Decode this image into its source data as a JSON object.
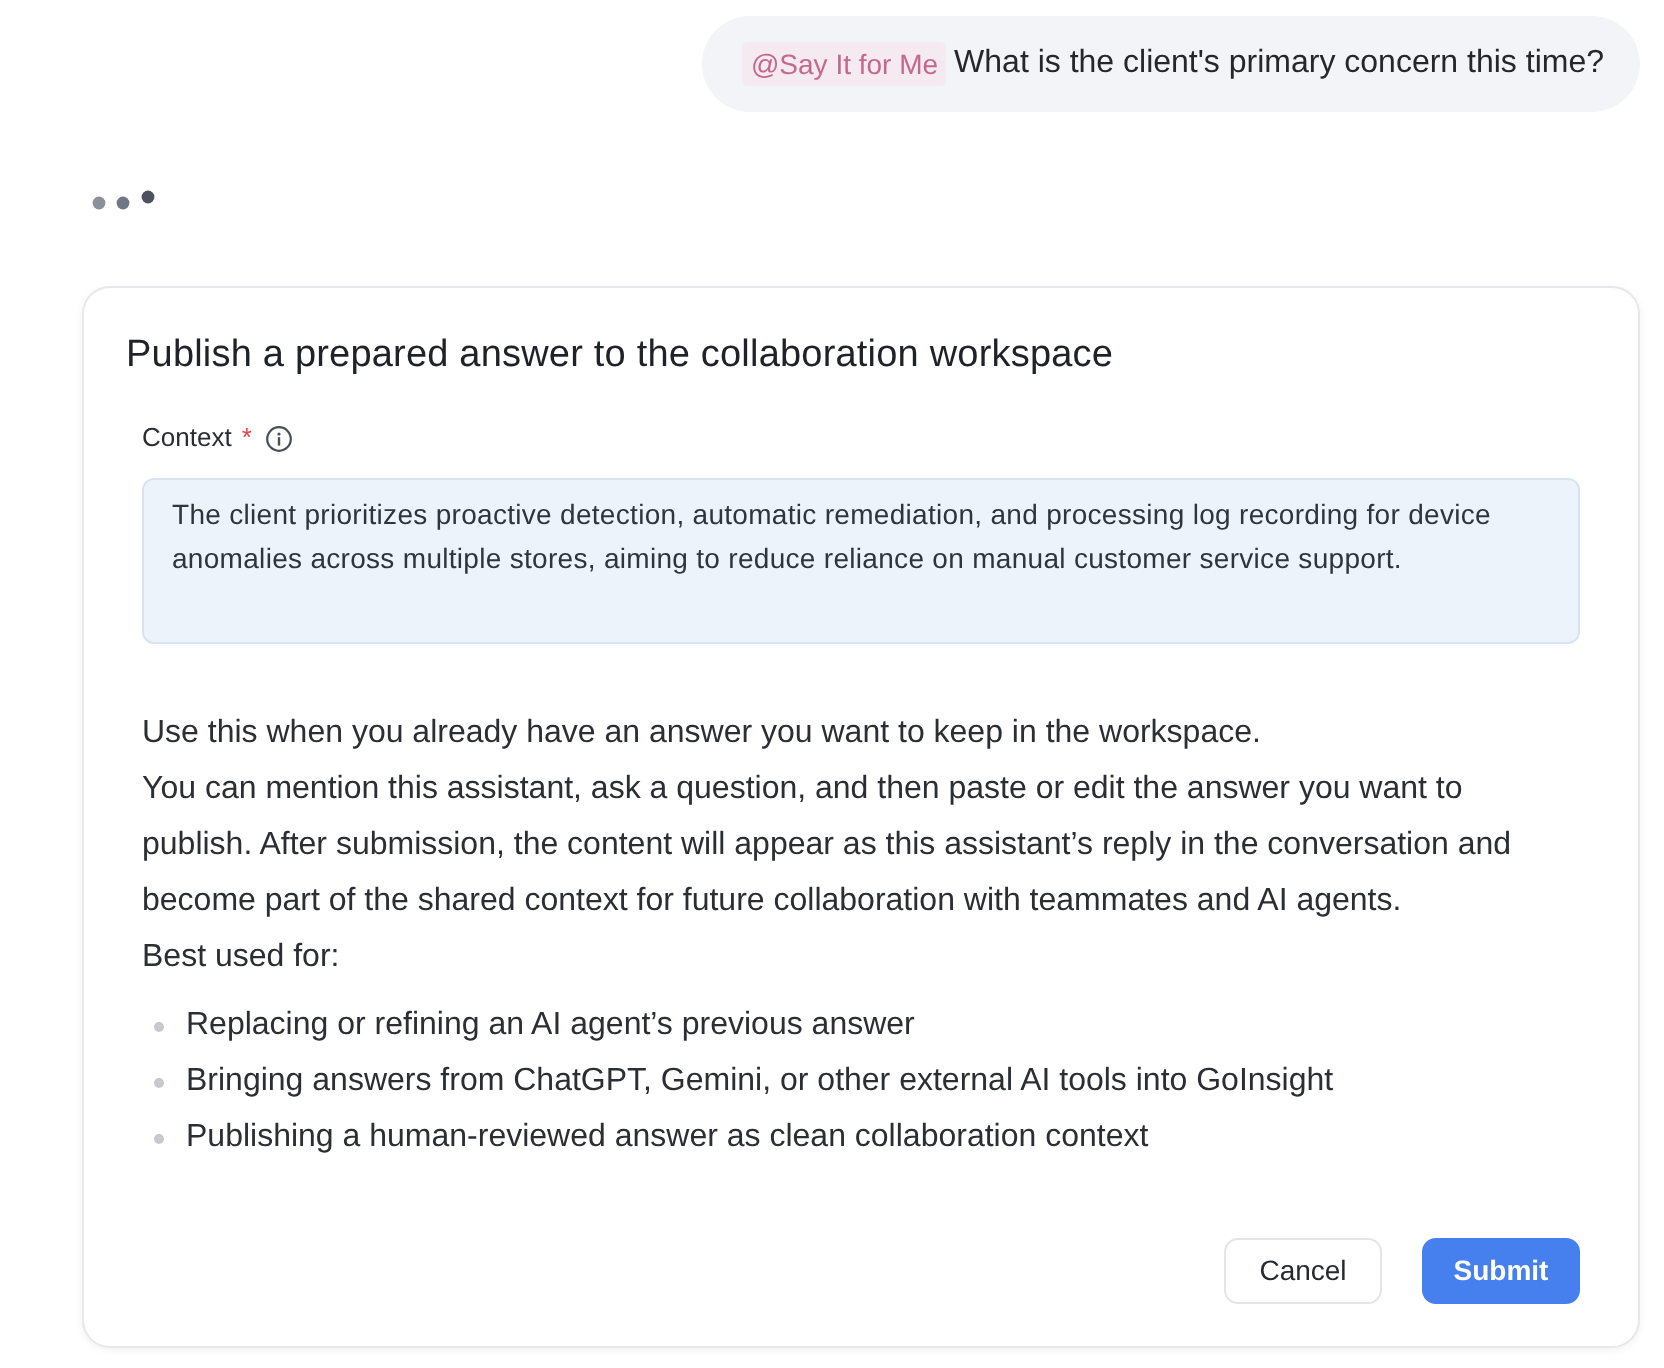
{
  "chat_message": {
    "mention": "@Say It for Me",
    "text": "What is the client's primary concern this time?"
  },
  "dialog": {
    "title": "Publish a prepared answer to the collaboration workspace",
    "field": {
      "label": "Context",
      "required_mark": "*",
      "value": "The client prioritizes proactive detection, automatic remediation, and processing log recording for device anomalies across multiple stores, aiming to reduce reliance on manual customer service support."
    },
    "description": [
      "Use this when you already have an answer you want to keep in the workspace.",
      "You can mention this assistant, ask a question, and then paste or edit the answer you want to publish. After submission, the content will appear as this assistant’s reply in the conversation and become part of the shared context for future collaboration with teammates and AI agents.",
      "Best used for:"
    ],
    "bullets": [
      "Replacing or refining an AI agent’s previous answer",
      "Bringing answers from ChatGPT, Gemini, or other external AI tools into GoInsight",
      "Publishing a human-reviewed answer as clean collaboration context"
    ],
    "buttons": [
      {
        "label": "Cancel",
        "kind": "secondary"
      },
      {
        "label": "Submit",
        "kind": "primary"
      }
    ]
  }
}
